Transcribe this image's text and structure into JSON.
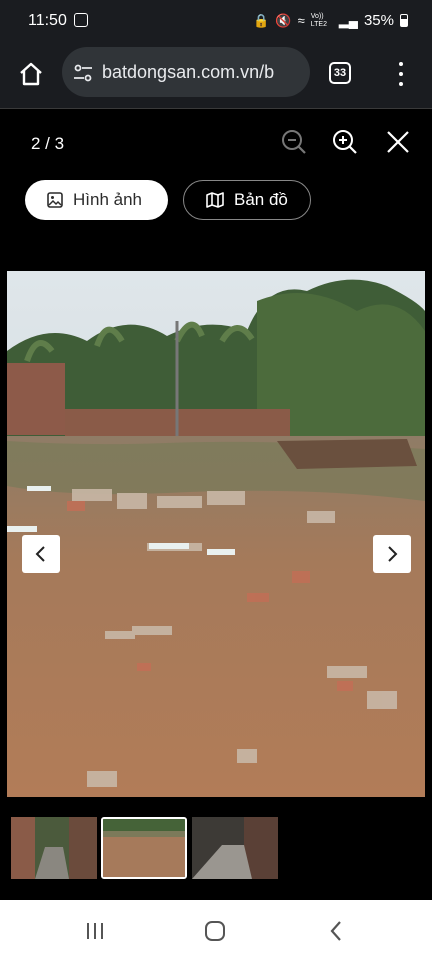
{
  "status_bar": {
    "time": "11:50",
    "network_label": "Vo)) LTE2",
    "battery": "35%"
  },
  "browser": {
    "url": "batdongsan.com.vn/b",
    "tab_count": "33"
  },
  "viewer": {
    "counter": "2 / 3",
    "tabs": [
      {
        "label": "Hình ảnh",
        "active": true
      },
      {
        "label": "Bản đồ",
        "active": false
      }
    ],
    "current_index": 2,
    "total": 3
  },
  "colors": {
    "background": "#000000",
    "toolbar": "#1a1c20",
    "url_field": "#303438"
  }
}
